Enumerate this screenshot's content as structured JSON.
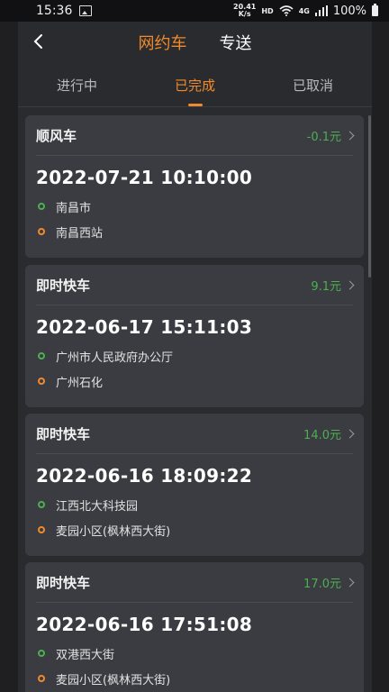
{
  "status_bar": {
    "time": "15:36",
    "speed_value": "20.41",
    "speed_unit": "K/s",
    "hd": "HD",
    "network": "4G",
    "battery": "100%"
  },
  "header": {
    "tabs": [
      "网约车",
      "专送"
    ],
    "active_tab": "网约车"
  },
  "order_tabs": {
    "items": [
      "进行中",
      "已完成",
      "已取消"
    ],
    "active": "已完成"
  },
  "orders": [
    {
      "type": "顺风车",
      "price": "-0.1元",
      "time": "2022-07-21 10:10:00",
      "start": "南昌市",
      "end": "南昌西站"
    },
    {
      "type": "即时快车",
      "price": "9.1元",
      "time": "2022-06-17 15:11:03",
      "start": "广州市人民政府办公厅",
      "end": "广州石化"
    },
    {
      "type": "即时快车",
      "price": "14.0元",
      "time": "2022-06-16 18:09:22",
      "start": "江西北大科技园",
      "end": "麦园小区(枫林西大街)"
    },
    {
      "type": "即时快车",
      "price": "17.0元",
      "time": "2022-06-16 17:51:08",
      "start": "双港西大街",
      "end": "麦园小区(枫林西大街)"
    }
  ],
  "colors": {
    "accent": "#f08a2c",
    "price_green": "#4caf50",
    "card_bg": "#3b3c41",
    "page_bg": "#2a2b2f"
  },
  "icons": {
    "back": "chevron-left-icon",
    "card_more": "chevron-right-icon",
    "start": "green-ring-dot-icon",
    "end": "orange-ring-dot-icon"
  }
}
